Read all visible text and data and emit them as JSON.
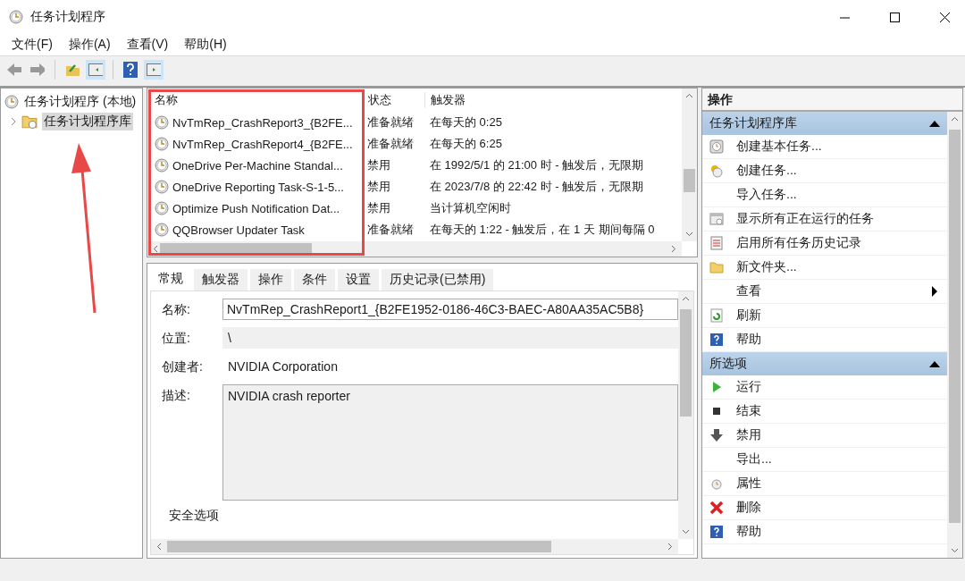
{
  "window": {
    "title": "任务计划程序"
  },
  "menu": [
    "文件(F)",
    "操作(A)",
    "查看(V)",
    "帮助(H)"
  ],
  "tree": {
    "label": "任务计划程序 (本地)",
    "children": [
      {
        "label": "任务计划程序库",
        "selected": true,
        "expanded": false
      }
    ]
  },
  "task_table": {
    "columns": [
      "名称",
      "状态",
      "触发器"
    ],
    "rows": [
      {
        "name": "NvTmRep_CrashReport3_{B2FE...",
        "status": "准备就绪",
        "trigger": "在每天的 0:25"
      },
      {
        "name": "NvTmRep_CrashReport4_{B2FE...",
        "status": "准备就绪",
        "trigger": "在每天的 6:25"
      },
      {
        "name": "OneDrive Per-Machine Standal...",
        "status": "禁用",
        "trigger": "在 1992/5/1 的 21:00 时 - 触发后，无限期"
      },
      {
        "name": "OneDrive Reporting Task-S-1-5...",
        "status": "禁用",
        "trigger": "在 2023/7/8 的 22:42 时 - 触发后，无限期"
      },
      {
        "name": "Optimize Push Notification Dat...",
        "status": "禁用",
        "trigger": "当计算机空闲时"
      },
      {
        "name": "QQBrowser Updater Task",
        "status": "准备就绪",
        "trigger": "在每天的 1:22 - 触发后，在 1 天 期间每隔 0"
      }
    ]
  },
  "detail_tabs": [
    {
      "label": "常规",
      "selected": true
    },
    {
      "label": "触发器",
      "selected": false
    },
    {
      "label": "操作",
      "selected": false
    },
    {
      "label": "条件",
      "selected": false
    },
    {
      "label": "设置",
      "selected": false
    },
    {
      "label": "历史记录(已禁用)",
      "selected": false
    }
  ],
  "general": {
    "name_label": "名称:",
    "name_value": "NvTmRep_CrashReport1_{B2FE1952-0186-46C3-BAEC-A80AA35AC5B8}",
    "location_label": "位置:",
    "location_value": "\\",
    "author_label": "创建者:",
    "author_value": "NVIDIA Corporation",
    "description_label": "描述:",
    "description_value": "NVIDIA crash reporter",
    "security_heading": "安全选项"
  },
  "actions_panel": {
    "title": "操作",
    "sections": [
      {
        "title": "任务计划程序库",
        "expanded": true,
        "items": [
          {
            "label": "创建基本任务...",
            "kind": "wizard"
          },
          {
            "label": "创建任务...",
            "kind": "task"
          },
          {
            "label": "导入任务...",
            "kind": "none"
          },
          {
            "label": "显示所有正在运行的任务",
            "kind": "running"
          },
          {
            "label": "启用所有任务历史记录",
            "kind": "history"
          },
          {
            "label": "新文件夹...",
            "kind": "folder"
          },
          {
            "label": "查看",
            "kind": "submenu"
          },
          {
            "label": "刷新",
            "kind": "refresh"
          },
          {
            "label": "帮助",
            "kind": "help"
          }
        ]
      },
      {
        "title": "所选项",
        "expanded": true,
        "items": [
          {
            "label": "运行",
            "kind": "run"
          },
          {
            "label": "结束",
            "kind": "stop"
          },
          {
            "label": "禁用",
            "kind": "disable"
          },
          {
            "label": "导出...",
            "kind": "none"
          },
          {
            "label": "属性",
            "kind": "properties"
          },
          {
            "label": "删除",
            "kind": "delete"
          },
          {
            "label": "帮助",
            "kind": "help"
          }
        ]
      }
    ]
  }
}
